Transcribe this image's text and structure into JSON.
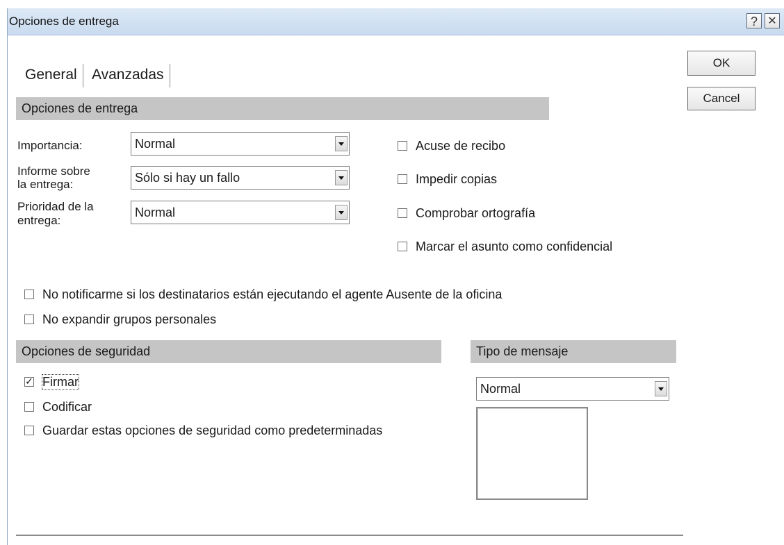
{
  "window": {
    "title": "Opciones de entrega",
    "help_label": "?",
    "close_label": "✕"
  },
  "tabs": [
    {
      "label": "General",
      "active": true
    },
    {
      "label": "Avanzadas",
      "active": false
    }
  ],
  "buttons": {
    "ok": "OK",
    "cancel": "Cancel"
  },
  "delivery": {
    "header": "Opciones de entrega",
    "importance": {
      "label": "Importancia:",
      "value": "Normal"
    },
    "report": {
      "label_line1": "Informe sobre",
      "label_line2": "la entrega:",
      "value": "Sólo si hay un fallo"
    },
    "priority": {
      "label_line1": "Prioridad de la",
      "label_line2": "entrega:",
      "value": "Normal"
    },
    "checks": [
      {
        "label": "Acuse de recibo",
        "checked": false
      },
      {
        "label": "Impedir copias",
        "checked": false
      },
      {
        "label": "Comprobar ortografía",
        "checked": false
      },
      {
        "label": "Marcar el asunto como confidencial",
        "checked": false
      }
    ]
  },
  "general_checks": [
    {
      "label": "No notificarme si los destinatarios están ejecutando el agente Ausente de la oficina",
      "checked": false
    },
    {
      "label": "No expandir grupos personales",
      "checked": false
    }
  ],
  "security": {
    "header": "Opciones de seguridad",
    "checks": [
      {
        "label": "Firmar",
        "checked": true,
        "mark": "✓"
      },
      {
        "label": "Codificar",
        "checked": false
      },
      {
        "label": "Guardar estas opciones de seguridad como predeterminadas",
        "checked": false
      }
    ]
  },
  "message_type": {
    "header": "Tipo de mensaje",
    "value": "Normal"
  }
}
